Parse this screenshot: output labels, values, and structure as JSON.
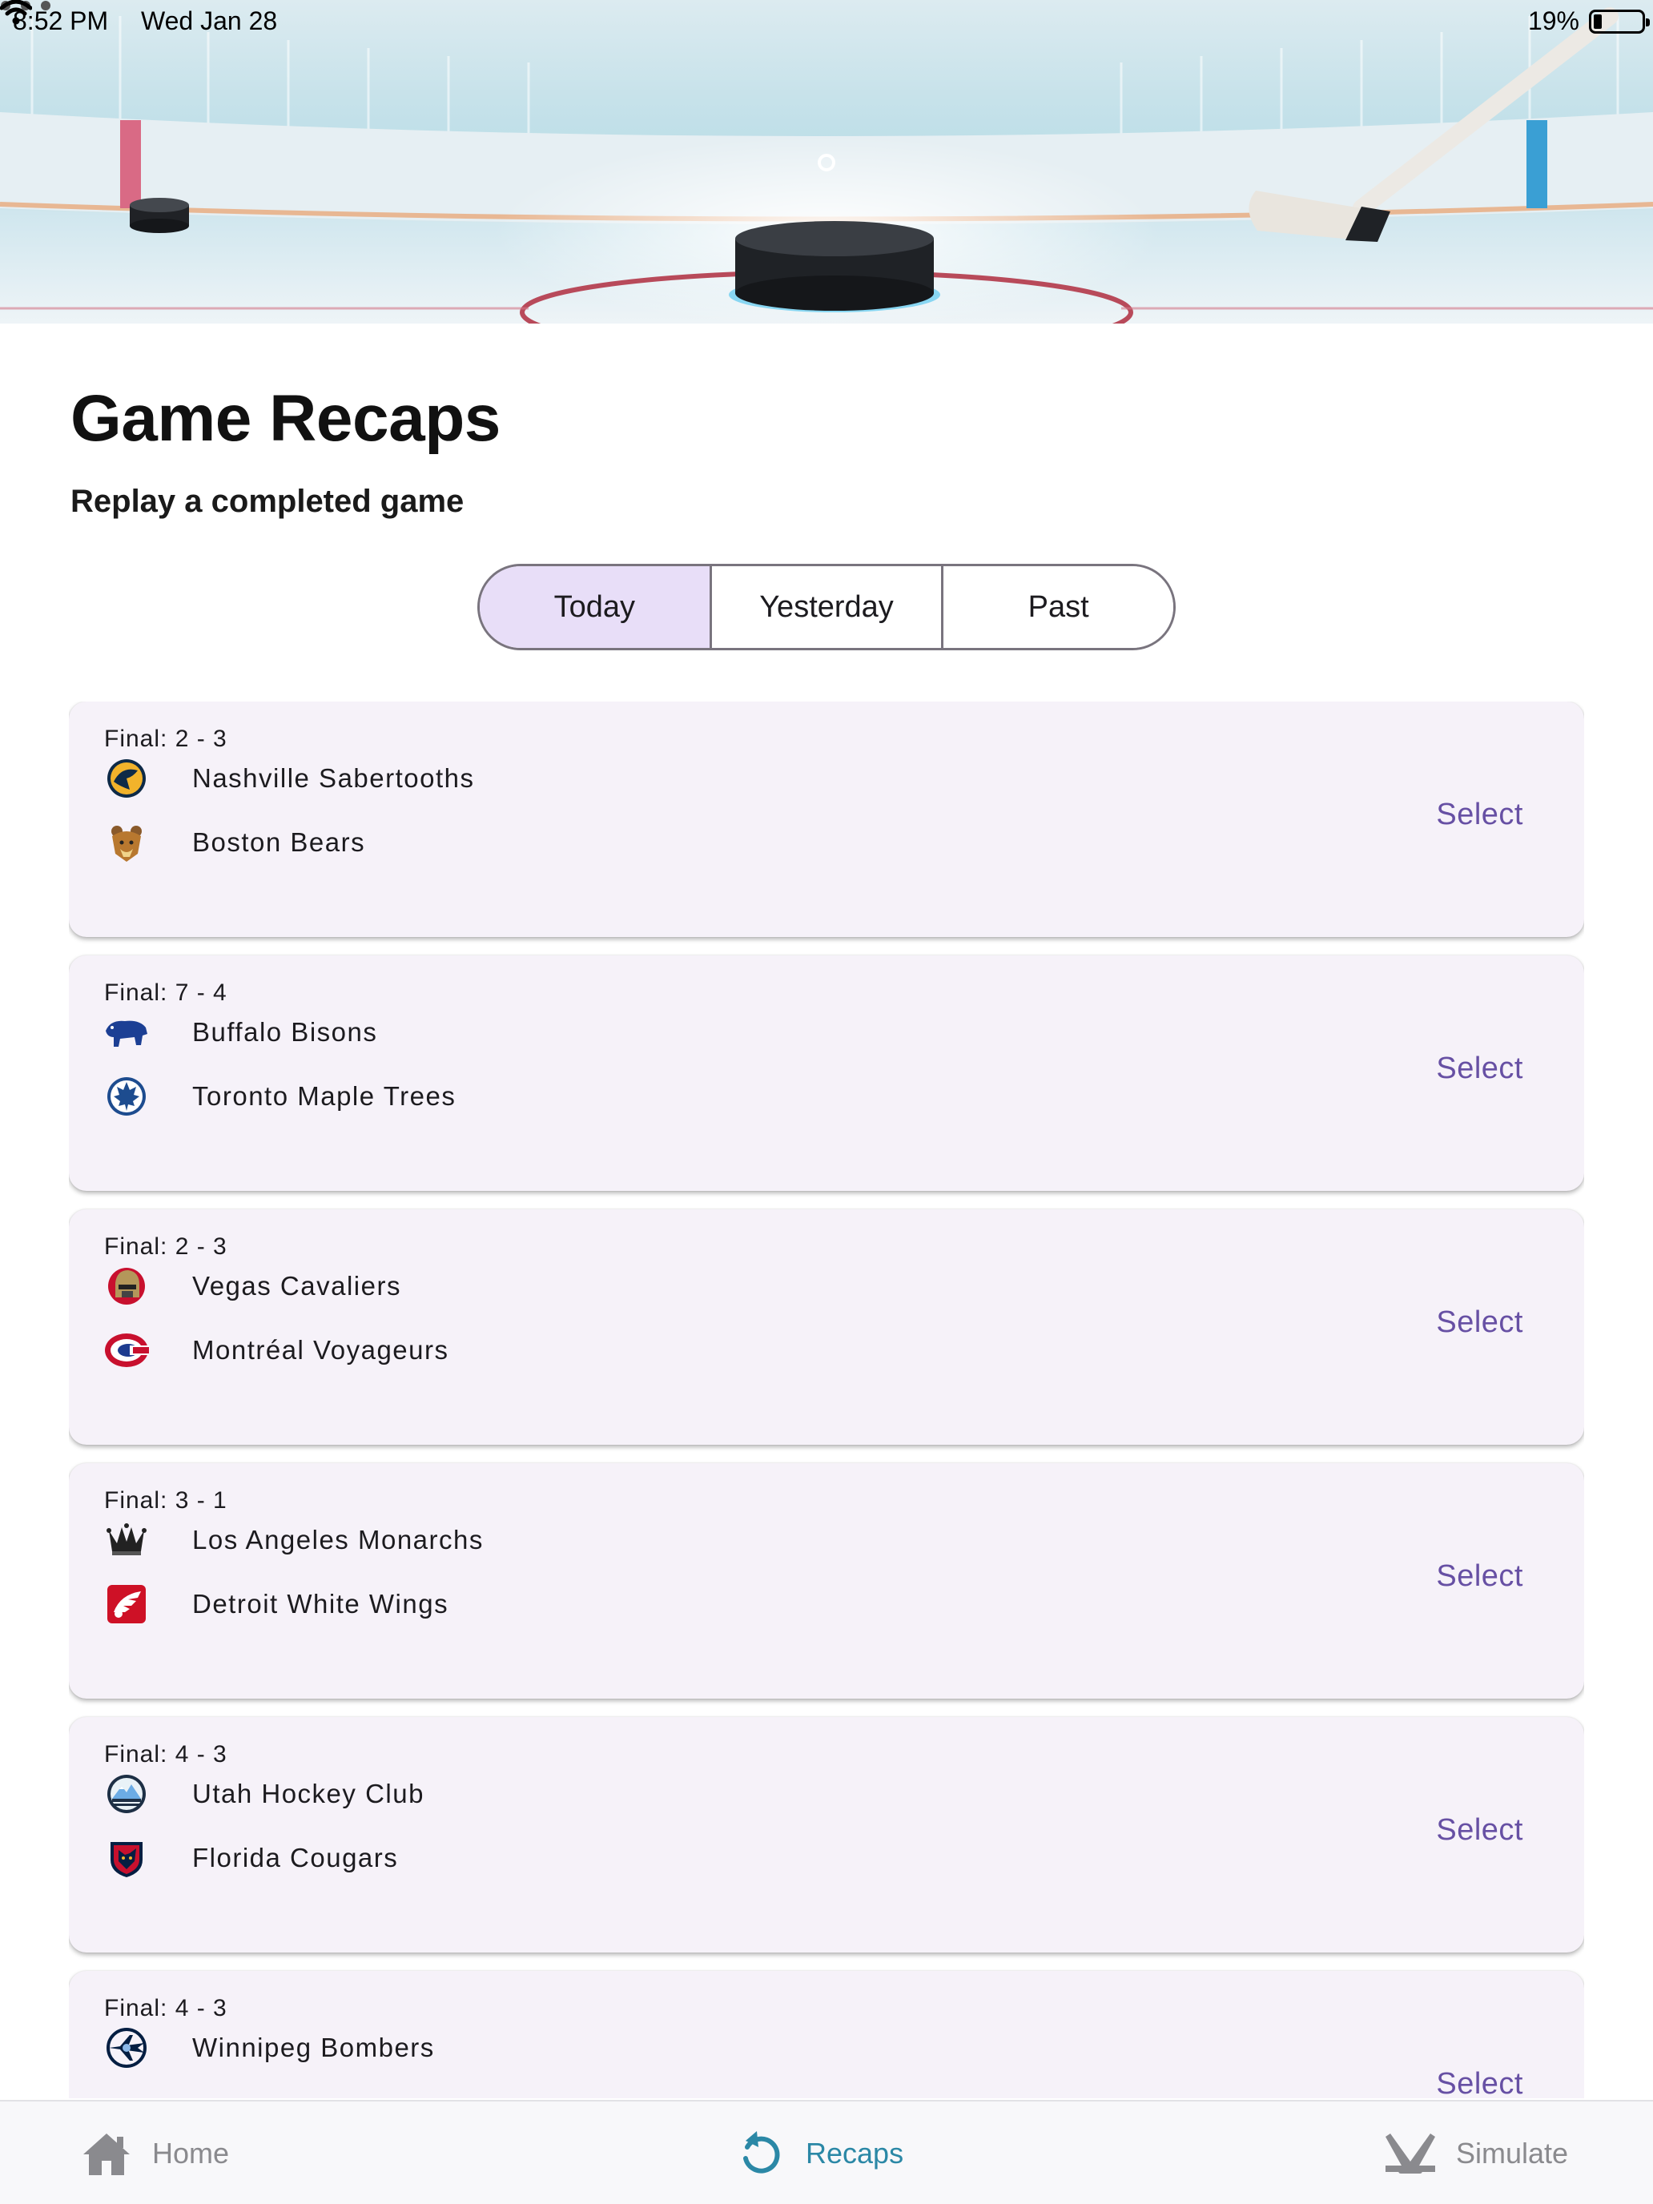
{
  "status_bar": {
    "time": "8:52 PM",
    "date": "Wed Jan 28",
    "battery": "19%"
  },
  "header": {
    "title": "Game Recaps",
    "subtitle": "Replay a completed game"
  },
  "tabs": [
    {
      "label": "Today",
      "active": true
    },
    {
      "label": "Yesterday",
      "active": false
    },
    {
      "label": "Past",
      "active": false
    }
  ],
  "games": [
    {
      "final": "Final: 2 - 3",
      "team1": "Nashville Sabertooths",
      "team1_logo": "sabertooth-logo-icon",
      "team2": "Boston Bears",
      "team2_logo": "bear-logo-icon",
      "action": "Select"
    },
    {
      "final": "Final: 7 - 4",
      "team1": "Buffalo Bisons",
      "team1_logo": "bison-logo-icon",
      "team2": "Toronto Maple Trees",
      "team2_logo": "maple-leaf-logo-icon",
      "action": "Select"
    },
    {
      "final": "Final: 2 - 3",
      "team1": "Vegas Cavaliers",
      "team1_logo": "knight-helmet-logo-icon",
      "team2": "Montréal Voyageurs",
      "team2_logo": "montreal-logo-icon",
      "action": "Select"
    },
    {
      "final": "Final: 3 - 1",
      "team1": "Los Angeles Monarchs",
      "team1_logo": "crown-logo-icon",
      "team2": "Detroit White Wings",
      "team2_logo": "wing-logo-icon",
      "action": "Select"
    },
    {
      "final": "Final: 4 - 3",
      "team1": "Utah Hockey Club",
      "team1_logo": "mountain-logo-icon",
      "team2": "Florida Cougars",
      "team2_logo": "cougar-logo-icon",
      "action": "Select"
    },
    {
      "final": "Final: 4 - 3",
      "team1": "Winnipeg Bombers",
      "team1_logo": "jet-logo-icon",
      "team2": "",
      "team2_logo": "",
      "action": "Select"
    }
  ],
  "bottom_nav": [
    {
      "label": "Home",
      "icon": "home-icon",
      "active": false
    },
    {
      "label": "Recaps",
      "icon": "replay-icon",
      "active": true
    },
    {
      "label": "Simulate",
      "icon": "hockey-sticks-icon",
      "active": false
    }
  ],
  "colors": {
    "accent": "#6750a4",
    "active_tab_bg": "#e8def8",
    "card_bg": "#f6f2f9",
    "nav_active": "#2b88a6"
  }
}
